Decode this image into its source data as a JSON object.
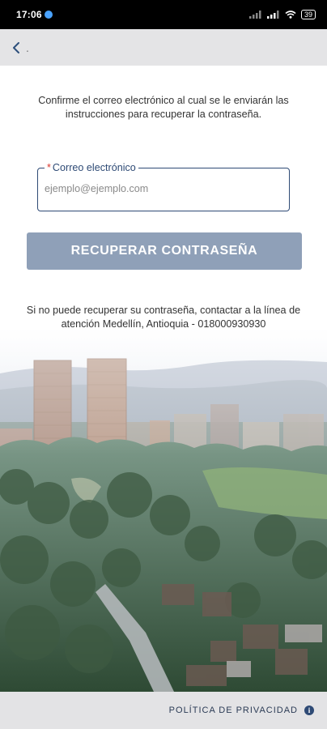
{
  "status_bar": {
    "time": "17:06",
    "battery": "39"
  },
  "header": {
    "back_label": "."
  },
  "recovery": {
    "intro_text": "Confirme el correo electrónico al cual se le enviarán las instrucciones para recuperar la contraseña.",
    "email_label_required": "*",
    "email_label": "Correo electrónico",
    "email_placeholder": "ejemplo@ejemplo.com",
    "email_value": "",
    "submit_label": "RECUPERAR CONTRASEÑA",
    "help_text": "Si no puede recuperar su contraseña, contactar a la línea de atención Medellín, Antioquia - 018000930930"
  },
  "footer": {
    "privacy_label": "POLÍTICA DE PRIVACIDAD"
  },
  "colors": {
    "accent": "#2e4a75",
    "button_disabled": "#8fa0b8",
    "required": "#d9342b",
    "topbar": "#e4e4e6"
  }
}
